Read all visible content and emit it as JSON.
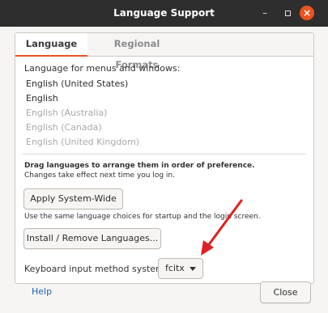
{
  "window": {
    "title": "Language Support",
    "minimize_glyph": "–",
    "close_glyph": "×"
  },
  "tabs": [
    {
      "label": "Language",
      "active": true
    },
    {
      "label": "Regional Formats",
      "active": false
    }
  ],
  "language": {
    "caption": "Language for menus and windows:",
    "items": [
      {
        "label": "English (United States)",
        "style": "strong"
      },
      {
        "label": "English",
        "style": "strong"
      },
      {
        "label": "English (Australia)",
        "style": "muted"
      },
      {
        "label": "English (Canada)",
        "style": "muted"
      },
      {
        "label": "English (United Kingdom)",
        "style": "muted"
      }
    ],
    "drag_hint": "Drag languages to arrange them in order of preference.",
    "change_hint": "Changes take effect next time you log in.",
    "apply_label": "Apply System-Wide",
    "same_hint": "Use the same language choices for startup and the login screen.",
    "install_label": "Install / Remove Languages...",
    "keyboard_label": "Keyboard input method system:",
    "keyboard_value": "fcitx"
  },
  "footer": {
    "help_label": "Help",
    "close_label": "Close"
  },
  "colors": {
    "titlebar": "#2e2e2e",
    "accent": "#e95420",
    "annotation_arrow": "#e02020",
    "link": "#1f5fb3"
  },
  "icons": {
    "minimize": "minimize-icon",
    "maximize": "maximize-icon",
    "close": "close-icon",
    "dropdown": "chevron-down-icon",
    "annotation": "red-arrow-annotation"
  }
}
